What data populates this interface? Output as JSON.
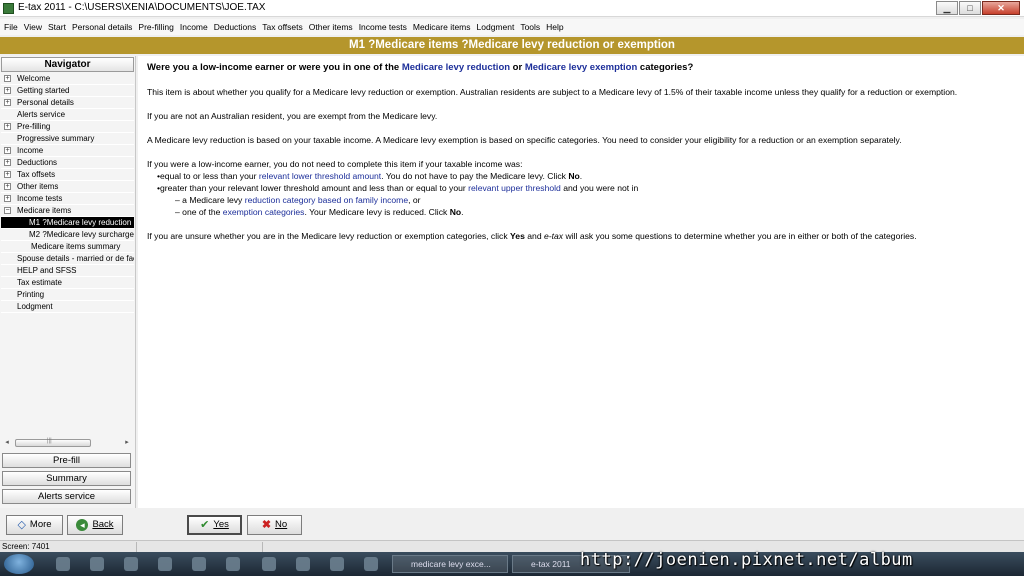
{
  "window": {
    "title": "E-tax 2011 - C:\\USERS\\XENIA\\DOCUMENTS\\JOE.TAX",
    "minimize_glyph": "▁",
    "maximize_glyph": "□",
    "close_glyph": "✕"
  },
  "menu": {
    "items": [
      "File",
      "View",
      "Start",
      "Personal details",
      "Pre-filling",
      "Income",
      "Deductions",
      "Tax offsets",
      "Other items",
      "Income tests",
      "Medicare items",
      "Lodgment",
      "Tools",
      "Help"
    ]
  },
  "banner": {
    "title": "M1 ?Medicare items ?Medicare levy reduction or exemption"
  },
  "navigator": {
    "title": "Navigator",
    "items": [
      {
        "label": "Welcome",
        "expander": "+"
      },
      {
        "label": "Getting started",
        "expander": "+"
      },
      {
        "label": "Personal details",
        "expander": "+"
      },
      {
        "label": "Alerts service",
        "expander": ""
      },
      {
        "label": "Pre-filling",
        "expander": "+"
      },
      {
        "label": "Progressive summary",
        "expander": ""
      },
      {
        "label": "Income",
        "expander": "+"
      },
      {
        "label": "Deductions",
        "expander": "+"
      },
      {
        "label": "Tax offsets",
        "expander": "+"
      },
      {
        "label": "Other items",
        "expander": "+"
      },
      {
        "label": "Income tests",
        "expander": "+"
      },
      {
        "label": "Medicare items",
        "expander": "−"
      },
      {
        "label": "M1 ?Medicare levy reduction",
        "expander": ""
      },
      {
        "label": "M2 ?Medicare levy surcharge",
        "expander": ""
      },
      {
        "label": "Medicare items summary",
        "expander": ""
      },
      {
        "label": "Spouse details - married or de facto",
        "expander": ""
      },
      {
        "label": "HELP and SFSS",
        "expander": ""
      },
      {
        "label": "Tax estimate",
        "expander": ""
      },
      {
        "label": "Printing",
        "expander": ""
      },
      {
        "label": "Lodgment",
        "expander": ""
      }
    ],
    "buttons": {
      "prefill": "Pre-fill",
      "summary": "Summary",
      "alerts": "Alerts service"
    }
  },
  "content": {
    "question": {
      "a": "Were you a low-income earner or were you in one of the ",
      "link1": "Medicare levy reduction",
      "b": " or ",
      "link2": "Medicare levy exemption",
      "c": " categories?"
    },
    "p1": "This item is about whether you qualify for a Medicare levy reduction or exemption. Australian residents are subject to a Medicare levy of 1.5% of their taxable income unless they qualify for a reduction or exemption.",
    "p2": "If you are not an Australian resident, you are exempt from the Medicare levy.",
    "p3": "A Medicare levy reduction is based on your taxable income. A Medicare levy exemption is based on specific categories. You need to consider your eligibility for a reduction or an exemption separately.",
    "p4_intro": "If you were a low-income earner, you do not need to complete this item if your taxable income was:",
    "b1": {
      "a": "•equal to or less than your ",
      "link": "relevant lower threshold amount",
      "b": ". You do not have to pay the Medicare levy. Click ",
      "bold": "No",
      "c": "."
    },
    "b2": {
      "a": "•greater than your relevant lower threshold amount and less than or equal to your ",
      "link": "relevant upper threshold",
      "b": " and you were not in"
    },
    "d1": {
      "a": "– a Medicare levy ",
      "link": "reduction category based on family income",
      "b": ", or"
    },
    "d2": {
      "a": "– one of the ",
      "link": "exemption categories",
      "b": ". Your Medicare levy is reduced. Click ",
      "bold": "No",
      "c": "."
    },
    "p5": {
      "a": "If you are unsure whether you are in the Medicare levy reduction or exemption categories, click ",
      "bold1": "Yes",
      "b": " and ",
      "italic": "e-tax",
      "c": " will ask you some questions to determine whether you are in either or both of the categories."
    }
  },
  "bottom": {
    "more": "More",
    "back": "Back",
    "yes": "Yes",
    "no": "No"
  },
  "status": {
    "screen": "Screen: 7401"
  },
  "taskbar": {
    "task1": "medicare levy exce...",
    "task2": "e-tax 2011"
  },
  "watermark": "http://joenien.pixnet.net/album",
  "colors": {
    "banner": "#b5962c",
    "link": "#1d2f9a",
    "selected_nav": "#000000"
  }
}
